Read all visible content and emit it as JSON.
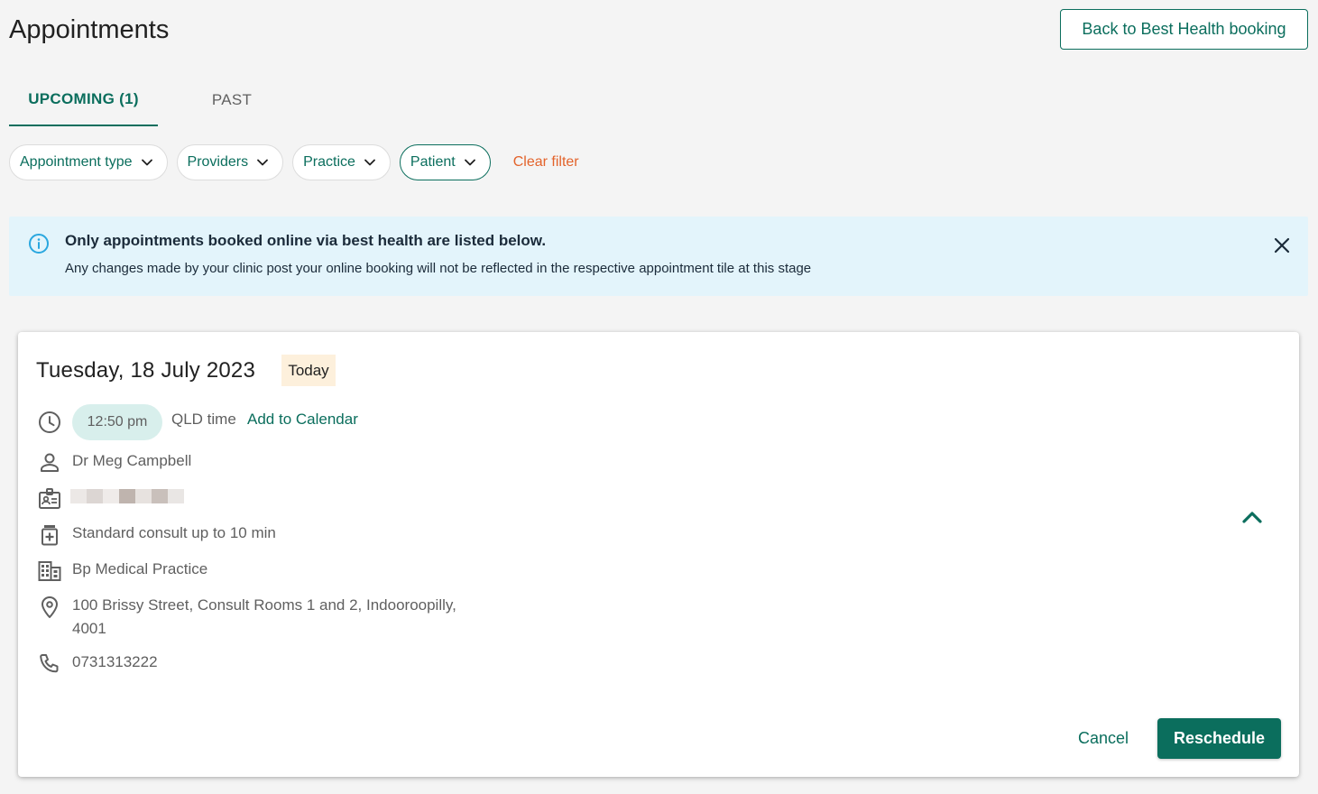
{
  "header": {
    "title": "Appointments",
    "back_label": "Back to Best Health booking"
  },
  "tabs": [
    {
      "label": "UPCOMING (1)",
      "active": true
    },
    {
      "label": "PAST",
      "active": false
    }
  ],
  "filters": {
    "chips": [
      {
        "label": "Appointment type",
        "active": false
      },
      {
        "label": "Providers",
        "active": false
      },
      {
        "label": "Practice",
        "active": false
      },
      {
        "label": "Patient",
        "active": true
      }
    ],
    "clear_label": "Clear filter"
  },
  "banner": {
    "title": "Only appointments booked online via best health are listed below.",
    "body": "Any changes made by your clinic post your online booking will not be reflected in the respective appointment tile at this stage"
  },
  "appointment": {
    "date": "Tuesday, 18 July 2023",
    "badge": "Today",
    "time": "12:50 pm",
    "timezone": "QLD time",
    "add_calendar_label": "Add to Calendar",
    "provider": "Dr Meg Campbell",
    "patient_redacted": true,
    "type": "Standard consult up to 10 min",
    "practice": "Bp Medical Practice",
    "address_line1": "100 Brissy Street, Consult Rooms 1 and 2, Indooroopilly,",
    "address_line2": "4001",
    "phone": "0731313222",
    "cancel_label": "Cancel",
    "reschedule_label": "Reschedule"
  },
  "icons": {
    "clock": "clock-icon",
    "person": "person-icon",
    "badge": "id-badge-icon",
    "consult": "medical-bag-icon",
    "practice": "building-icon",
    "location": "location-pin-icon",
    "phone": "phone-icon",
    "info": "info-icon",
    "close": "close-icon",
    "collapse": "chevron-up-icon",
    "dropdown": "chevron-down-icon"
  },
  "colors": {
    "primary": "#0b6e5d",
    "accent": "#e3632b",
    "banner_bg": "#e3f4fb",
    "info_icon": "#2aa7df",
    "today_bg": "#fdf0dc",
    "time_pill_bg": "#d8efec",
    "page_bg": "#f4f4f4"
  }
}
